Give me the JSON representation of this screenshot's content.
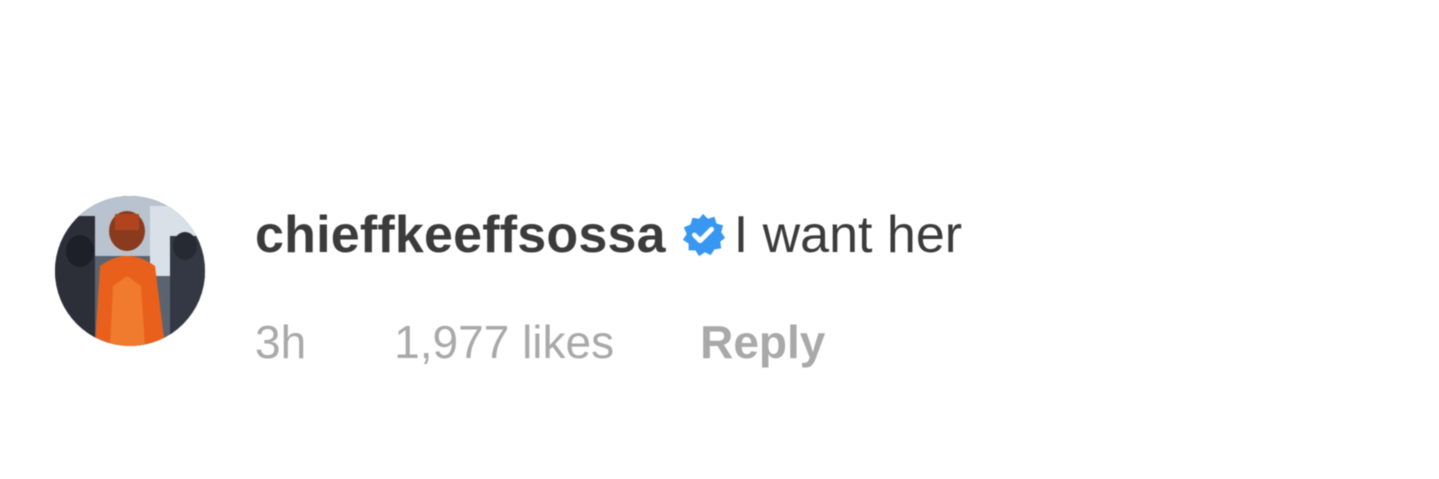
{
  "comment": {
    "username": "chieffkeeffsossa",
    "verified": true,
    "text": "I want her",
    "time": "3h",
    "likes": "1,977 likes",
    "reply_label": "Reply",
    "avatar_icon": "profile-photo",
    "verified_icon": "verified-badge-icon"
  },
  "colors": {
    "username": "#3b3b3b",
    "meta": "#a9a9a9",
    "verified_badge": "#3897f0",
    "avatar_accent": "#e8601c"
  }
}
